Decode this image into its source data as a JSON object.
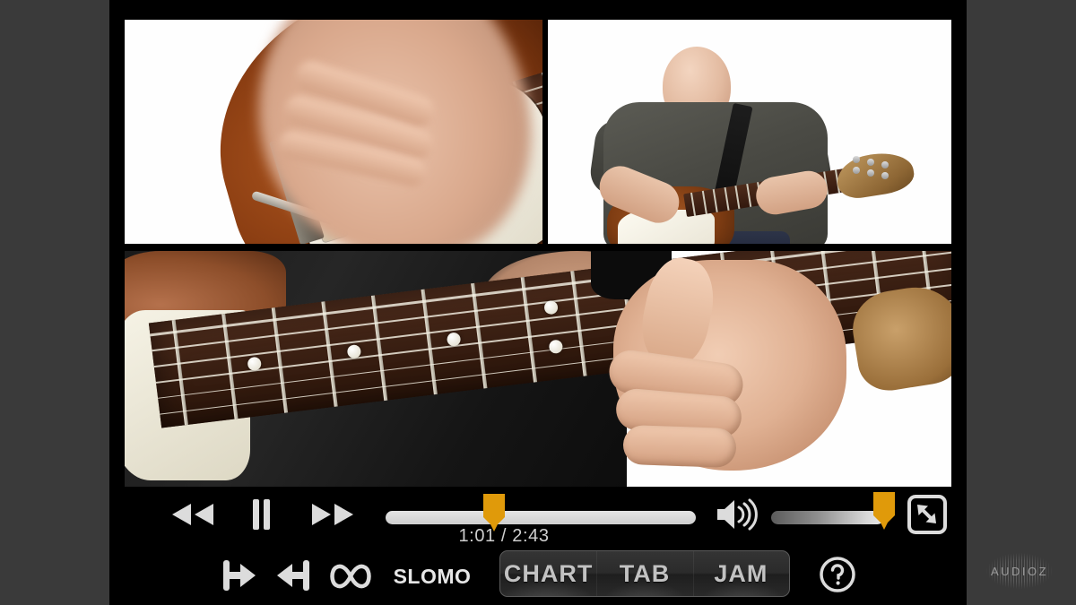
{
  "app": {
    "title": "Guitar Lesson Video Player",
    "accent_color": "#E09A0A",
    "bar_background": "#000000",
    "page_background": "#3a3a3a",
    "icon_color": "#DCDCDC"
  },
  "video": {
    "panels": [
      {
        "id": "top-left",
        "caption": "Strumming hand close-up on sunburst Stratocaster"
      },
      {
        "id": "top-right",
        "caption": "Full body shot of guitarist playing"
      },
      {
        "id": "bottom",
        "caption": "Fretboard close-up with fretting hand"
      }
    ]
  },
  "transport": {
    "rewind_label": "Rewind",
    "rewind_icon": "rewind-icon",
    "pause_label": "Pause",
    "pause_icon": "pause-icon",
    "forward_label": "Fast Forward",
    "forward_icon": "fast-forward-icon",
    "time_display": "1:01 / 2:43",
    "current_time": "1:01",
    "total_time": "2:43",
    "progress_percent": 35,
    "scrub_label": "Playback position"
  },
  "volume": {
    "icon": "speaker-volume-icon",
    "label": "Volume",
    "level_percent": 100
  },
  "fullscreen": {
    "icon": "fullscreen-expand-icon",
    "label": "Toggle fullscreen"
  },
  "tools": {
    "loop_in_icon": "loop-in-icon",
    "loop_in_label": "Set loop start",
    "loop_out_icon": "loop-out-icon",
    "loop_out_label": "Set loop end",
    "loop_icon": "infinity-loop-icon",
    "loop_label": "Loop",
    "slomo_label": "SLOMO"
  },
  "view_modes": {
    "options": [
      {
        "id": "chart",
        "label": "CHART"
      },
      {
        "id": "tab",
        "label": "TAB"
      },
      {
        "id": "jam",
        "label": "JAM"
      }
    ],
    "selected": ""
  },
  "help": {
    "icon": "question-mark-circle-icon",
    "label": "Help"
  },
  "watermark": {
    "text": "AUDIOZ"
  }
}
